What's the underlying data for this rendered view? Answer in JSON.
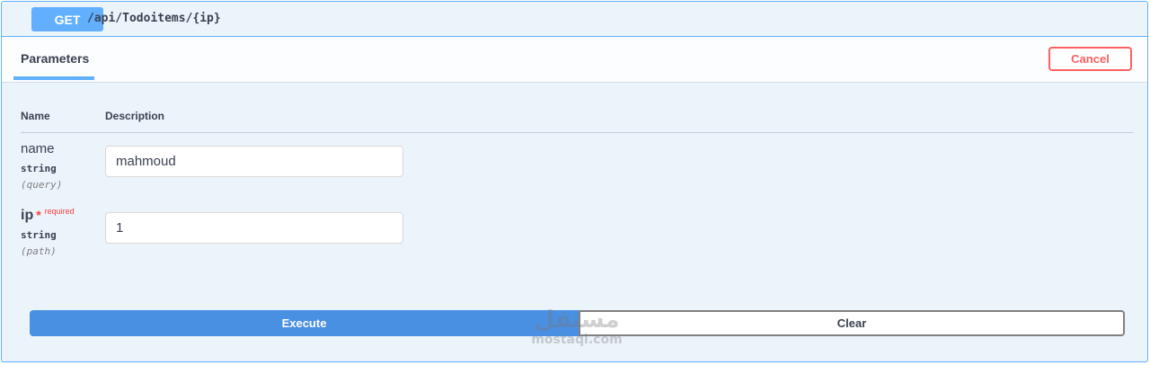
{
  "operation": {
    "method": "GET",
    "path": "/api/Todoitems/{ip}"
  },
  "section": {
    "tab_label": "Parameters",
    "cancel_label": "Cancel"
  },
  "table": {
    "headers": {
      "name": "Name",
      "description": "Description"
    }
  },
  "params": [
    {
      "name": "name",
      "type": "string",
      "in": "(query)",
      "value": "mahmoud",
      "required": false
    },
    {
      "name": "ip",
      "type": "string",
      "in": "(path)",
      "value": "1",
      "required": true,
      "required_star": "*",
      "required_label": "required"
    }
  ],
  "actions": {
    "execute_label": "Execute",
    "clear_label": "Clear"
  },
  "watermark": {
    "arabic": "مستقل",
    "latin": "mostaql.com"
  },
  "colors": {
    "get_accent": "#61affe",
    "execute_bg": "#4990e2",
    "cancel_red": "#ff6060",
    "required_red": "#ff3d3d"
  }
}
